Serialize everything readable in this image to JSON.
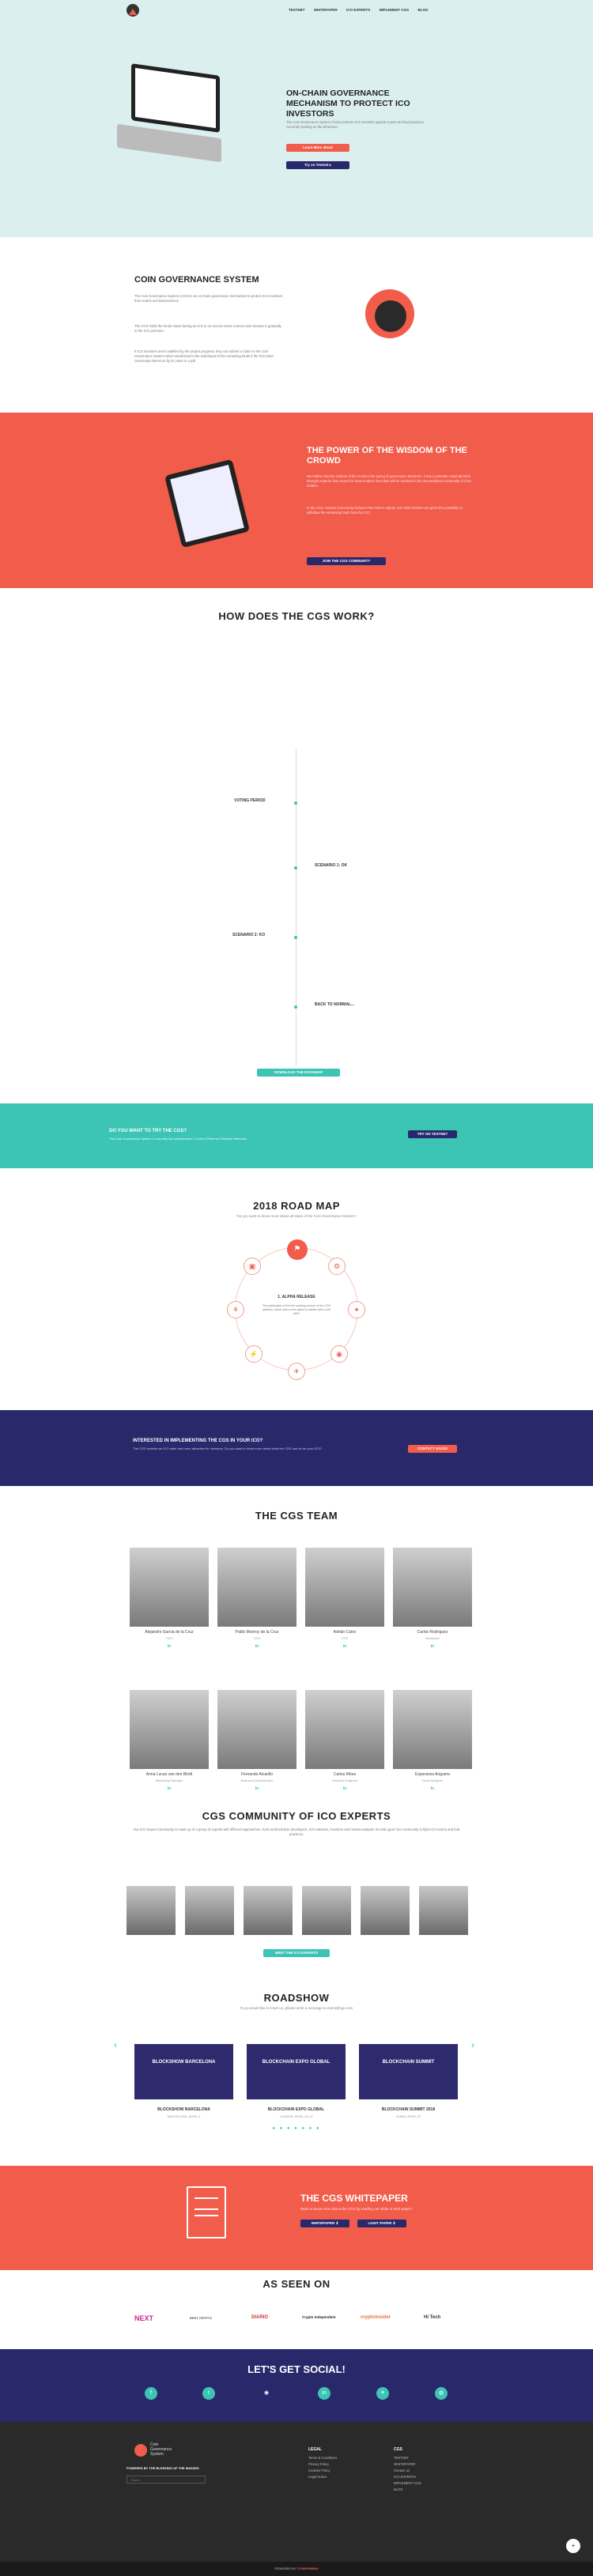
{
  "nav": {
    "items": [
      "TESTNET",
      "WHITEPAPER",
      "ICO EXPERTS",
      "IMPLEMENT CGS",
      "BLOG"
    ]
  },
  "hero": {
    "title": "ON-CHAIN GOVERNANCE MECHANISM TO PROTECT ICO INVESTORS",
    "text": "The Coin Governance System (CGS) protects ICO investors against scams and bad practices. Currently working on the Ethereum.",
    "btn1": "Learn More about",
    "btn2": "Try on Testnet ▸"
  },
  "cgs": {
    "title": "COIN GOVERNANCE SYSTEM",
    "p1": "The Coin Governance System (CGS) is an on-chain governance mechanism to protect ICO investors from scams and bad practices.",
    "p2": "The CGS holds the funds raised during an ICO in an escrow smart contract and releases it gradually to the ICO promoter.",
    "p3": "If ICO investors aren't satisfied by the project progress, they can submit a Claim to the Coin Governance System which would lead to the withdrawal of the remaining funds if the ICO token community deems so by its votes in a poll."
  },
  "crowd": {
    "title": "THE POWER OF THE WISDOM OF THE CROWD",
    "p1": "We believe that the wisdom of the crowd is the spring of governance decisions. It has a potential crowd decision strength superior than most ICO team leaders: the token will be resolved in the decentralised community of CGS holders.",
    "p2": "In the CGS, Holders Community behaves like token's nightly. ICO token holders are given the possibility to withdraw the remaining funds from the ICO.",
    "btn": "JOIN THE CGS COMMUNITY"
  },
  "how": {
    "title": "HOW DOES THE CGS WORK?",
    "steps": [
      "VOTING PERIOD",
      "SCENARIO 1: OK",
      "SCENARIO 2: KO",
      "BACK TO NORMAL..."
    ],
    "btn": "DOWNLOAD THE ROADMAP"
  },
  "try": {
    "title": "DO YOU WANT TO TRY THE CGS?",
    "text": "The Coin Governance System is currently live operational in Current: Ethereum Rinkeby Networks.",
    "btn": "TRY ON TESTNET"
  },
  "roadmap": {
    "title": "2018 ROAD MAP",
    "sub": "Do you want to know more about all steps of the Coin Governance System?",
    "step": "1. ALPHA RELEASE",
    "desc": "The publication of the first working version of the CGS platform, which was on the alpha-to-market with a UIS MVP.",
    "icons": [
      "⚑",
      "⚙",
      "✦",
      "◉",
      "✈",
      "⚡",
      "⚘",
      "▣"
    ]
  },
  "implement": {
    "title": "INTERESTED IN IMPLEMENTING THE CGS IN YOUR ICO?",
    "text": "The CGS enables an ICO safer and more attractive for investors. Do you want to know more about what the CGS can do for your ICO?",
    "btn": "CONTACT SALES"
  },
  "team": {
    "title": "THE CGS TEAM",
    "members": [
      {
        "name": "Alejandro Garcia de la Cruz",
        "role": "CEO"
      },
      {
        "name": "Pablo Monroy de la Cruz",
        "role": "COO"
      },
      {
        "name": "Adrián Calvo",
        "role": "CTO"
      },
      {
        "name": "Carlos Rodríguez",
        "role": "Developer"
      },
      {
        "name": "Anna Lucas van den Bindt",
        "role": "Marketing Manager"
      },
      {
        "name": "Fernando Alcarillo",
        "role": "Business Development"
      },
      {
        "name": "Carlos Mesa",
        "role": "Software Engineer"
      },
      {
        "name": "Esperanza Anguera",
        "role": "Head Designer"
      }
    ],
    "li": "in"
  },
  "experts": {
    "title": "CGS COMMUNITY OF ICO EXPERTS",
    "text": "Our ICO Expert Community is made up of a group of experts with different approaches, such as blockchain developers, ICO advisors, investors and market analysts. Its main goal: Get community to fight ICO scams and bad practices.",
    "btn": "MEET THE ICO EXPERTS"
  },
  "roadshow": {
    "title": "ROADSHOW",
    "sub": "If you would like to meet us, please write a message to event@cgs.com",
    "events": [
      {
        "banner": "BLOCKSHOW BARCELONA",
        "name": "BLOCKSHOW BARCELONA",
        "date": "BARCELONA, APRIL 4"
      },
      {
        "banner": "BLOCKCHAIN EXPO GLOBAL",
        "name": "BLOCKCHAIN EXPO GLOBAL",
        "date": "LONDON, APRIL 18-19"
      },
      {
        "banner": "BLOCKCHAIN SUMMIT",
        "name": "BLOCKCHAIN SUMMIT 2018",
        "date": "DUBAI, APRIL 22"
      }
    ]
  },
  "whitepaper": {
    "title": "THE CGS WHITEPAPER",
    "text": "Want to know more about the CGS by reading our white or tech paper?",
    "btn1": "WHITEPAPER ⬇",
    "btn2": "LIGHT PAPER ⬇"
  },
  "seen": {
    "title": "AS SEEN ON",
    "logos": [
      "NEXT",
      "BEST CRYPTO",
      "DIARIO",
      "Crypto Independent",
      "cryptoinsider",
      "Hi Tech"
    ]
  },
  "social": {
    "title": "LET'S GET SOCIAL!",
    "icons": [
      "f",
      "t",
      "◉",
      "M",
      "in",
      "✈",
      "◍"
    ]
  },
  "footer": {
    "brand1": "Coin",
    "brand2": "Governance",
    "brand3": "System",
    "powered": "POWERED BY THE BLESSING OF THE MASSES",
    "search": "Search",
    "col1_title": "LEGAL",
    "col1": [
      "Terms & Conditions",
      "Privacy Policy",
      "Cookies Policy",
      "Legal Notice"
    ],
    "col2_title": "CGS",
    "col2": [
      "TESTNET",
      "WHITEPAPER",
      "Contact us",
      "ICO EXPERTS",
      "IMPLEMENT CGS",
      "BLOG"
    ],
    "bottom": "POWERED BY",
    "bottom_brand": "COINFIRMING"
  },
  "colors": {
    "accent": "#f25c4a",
    "teal": "#3cc4b4",
    "navy": "#29286b",
    "hero_bg": "#dcefef"
  }
}
